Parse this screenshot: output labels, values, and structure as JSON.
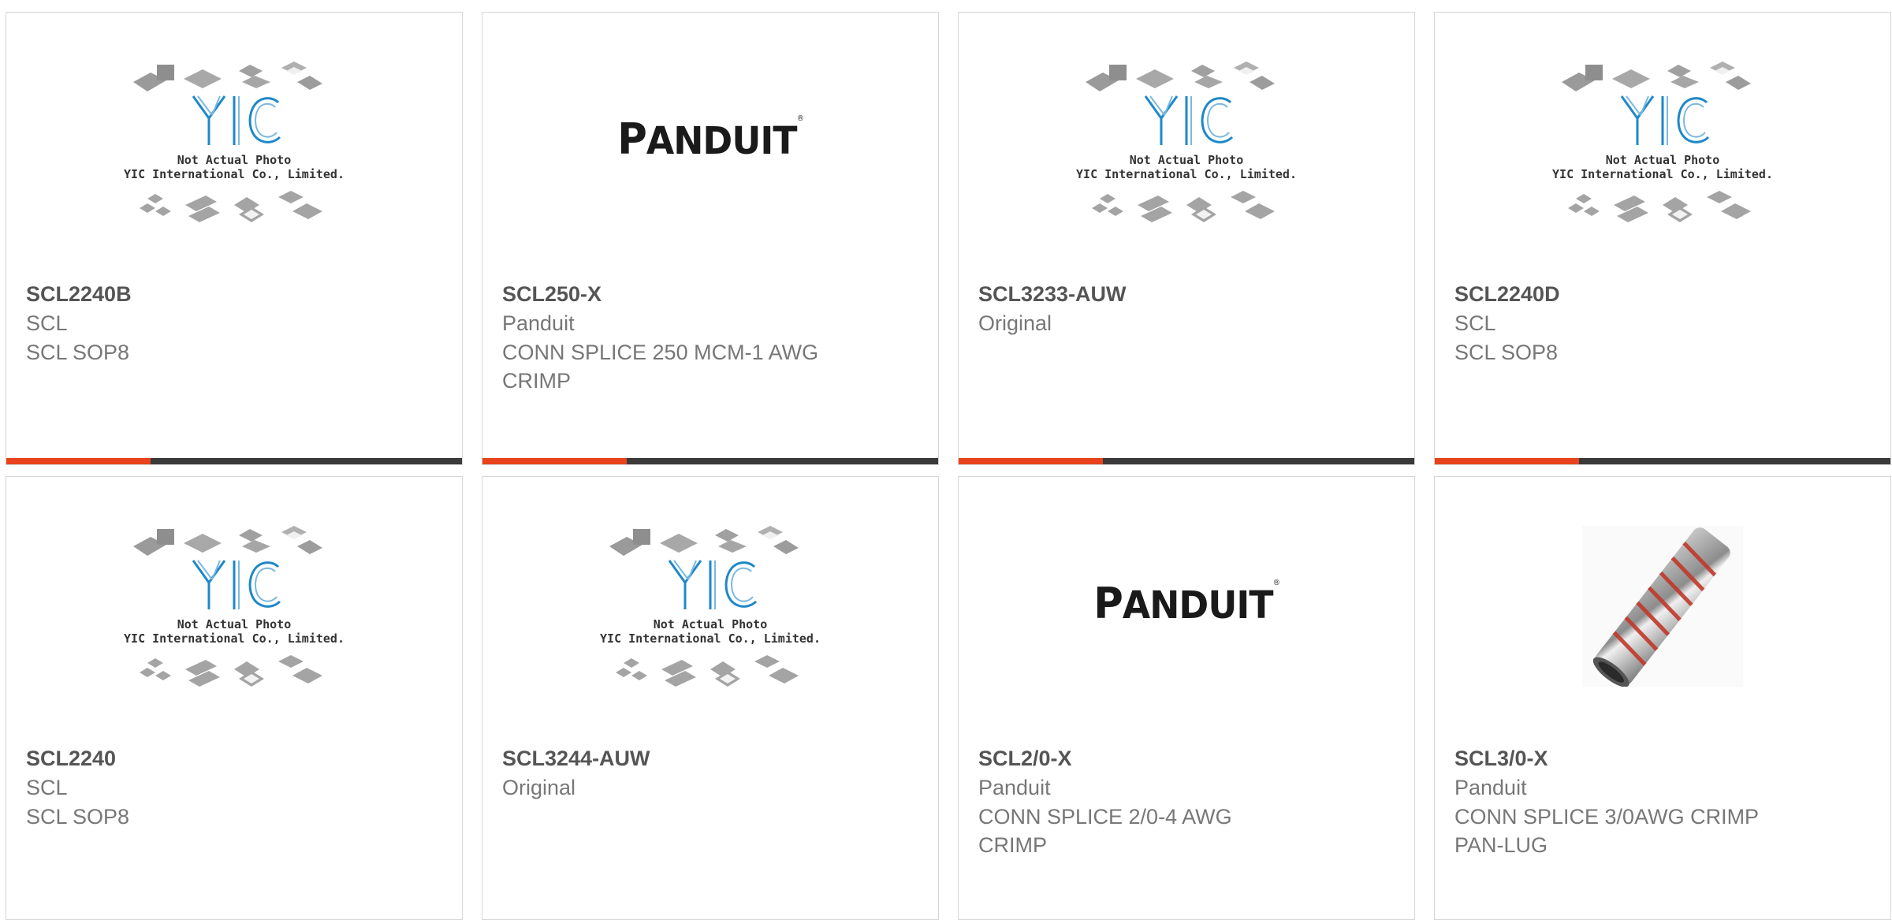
{
  "placeholder": {
    "line1": "Not Actual Photo",
    "line2": "YIC International Co., Limited.",
    "logo_text": "YIC"
  },
  "panduit_logo": {
    "text_big": "P",
    "text_rest": "ANDUIT",
    "reg": "®"
  },
  "colors": {
    "accent": "#e8431c",
    "bar": "#3a3a3a",
    "border": "#d6d6d6",
    "yic_blue": "#1e88c8"
  },
  "products": [
    {
      "part_number": "SCL2240B",
      "manufacturer": "SCL",
      "description": "SCL SOP8",
      "image": "yic-placeholder"
    },
    {
      "part_number": "SCL250-X",
      "manufacturer": "Panduit",
      "description_line1": "CONN SPLICE 250 MCM-1 AWG",
      "description_line2": "CRIMP",
      "image": "panduit-logo"
    },
    {
      "part_number": "SCL3233-AUW",
      "manufacturer": "Original",
      "image": "yic-placeholder"
    },
    {
      "part_number": "SCL2240D",
      "manufacturer": "SCL",
      "description": "SCL SOP8",
      "image": "yic-placeholder"
    },
    {
      "part_number": "SCL2240",
      "manufacturer": "SCL",
      "description": "SCL SOP8",
      "image": "yic-placeholder"
    },
    {
      "part_number": "SCL3244-AUW",
      "manufacturer": "Original",
      "image": "yic-placeholder"
    },
    {
      "part_number": "SCL2/0-X",
      "manufacturer": "Panduit",
      "description_line1": "CONN SPLICE 2/0-4 AWG",
      "description_line2": "CRIMP",
      "image": "panduit-logo"
    },
    {
      "part_number": "SCL3/0-X",
      "manufacturer": "Panduit",
      "description_line1": "CONN SPLICE 3/0AWG CRIMP",
      "description_line2": "PAN-LUG",
      "image": "splice-photo"
    }
  ]
}
